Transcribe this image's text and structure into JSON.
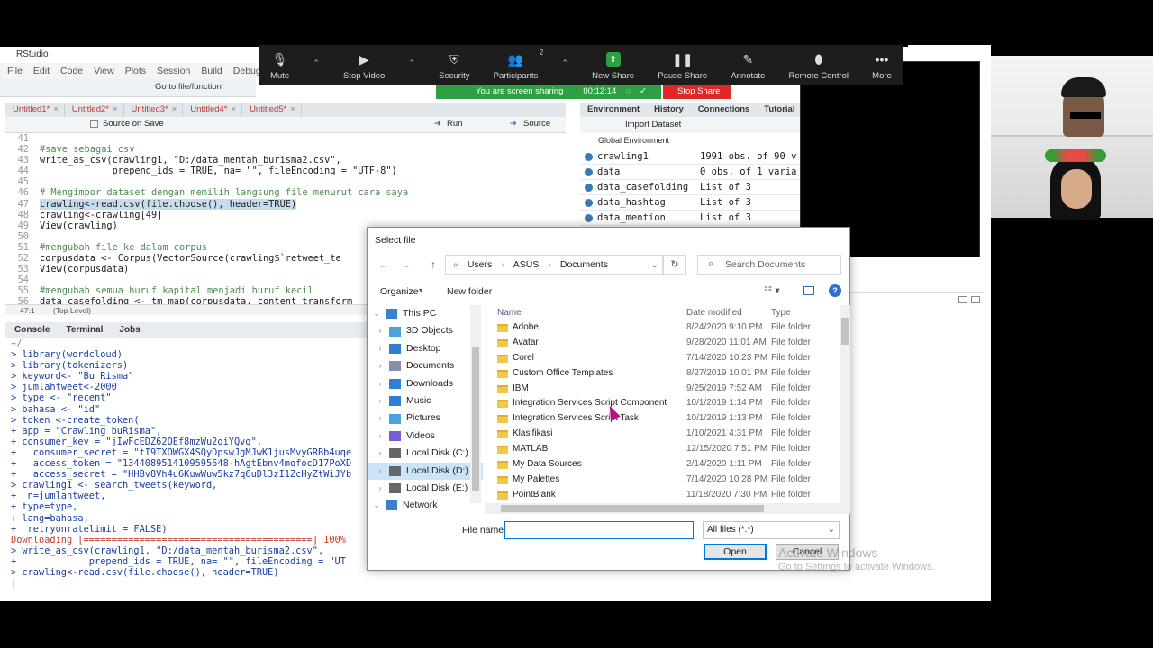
{
  "rstudio": {
    "title": "RStudio",
    "menu": [
      "File",
      "Edit",
      "Code",
      "View",
      "Plots",
      "Session",
      "Build",
      "Debug"
    ],
    "goto_placeholder": "Go to file/function",
    "editor_tabs": [
      "Untitled1*",
      "Untitled2*",
      "Untitled3*",
      "Untitled4*",
      "Untitled5*"
    ],
    "editor_toolbar": {
      "source_on_save": "Source on Save",
      "run": "Run",
      "source": "Source"
    },
    "code_lines": [
      {
        "n": "41",
        "text": ""
      },
      {
        "n": "42",
        "text": "#save sebagai csv",
        "comment": true
      },
      {
        "n": "43",
        "text": "write_as_csv(crawling1, \"D:/data_mentah_burisma2.csv\","
      },
      {
        "n": "44",
        "text": "             prepend_ids = TRUE, na= \"\", fileEncoding = \"UTF-8\")"
      },
      {
        "n": "45",
        "text": ""
      },
      {
        "n": "46",
        "text": "# Mengimpor dataset dengan memilih langsung file menurut cara saya",
        "comment": true
      },
      {
        "n": "47",
        "text": "crawling<-read.csv(file.choose(), header=TRUE)",
        "highlight": true
      },
      {
        "n": "48",
        "text": "crawling<-crawling[49]"
      },
      {
        "n": "49",
        "text": "View(crawling)"
      },
      {
        "n": "50",
        "text": ""
      },
      {
        "n": "51",
        "text": "#mengubah file ke dalam corpus",
        "comment": true
      },
      {
        "n": "52",
        "text": "corpusdata <- Corpus(VectorSource(crawling$`retweet_te"
      },
      {
        "n": "53",
        "text": "View(corpusdata)"
      },
      {
        "n": "54",
        "text": ""
      },
      {
        "n": "55",
        "text": "#mengubah semua huruf kapital menjadi huruf kecil",
        "comment": true
      },
      {
        "n": "56",
        "text": "data_casefolding <- tm_map(corpusdata, content_transform"
      }
    ],
    "editor_status": {
      "pos": "47:1",
      "scope": "(Top Level)"
    },
    "console_tabs": [
      "Console",
      "Terminal",
      "Jobs"
    ],
    "console_lines": [
      {
        "text": "~/",
        "kind": "plain"
      },
      {
        "text": "> library(wordcloud)"
      },
      {
        "text": "> library(tokenizers)"
      },
      {
        "text": "> keyword<- \"Bu Risma\""
      },
      {
        "text": "> jumlahtweet<-2000"
      },
      {
        "text": "> type <- \"recent\""
      },
      {
        "text": "> bahasa <- \"id\""
      },
      {
        "text": "> token <-create_token("
      },
      {
        "text": "+ app = \"Crawling buRisma\","
      },
      {
        "text": "+ consumer_key = \"jIwFcEDZ62OEf8mzWu2qiYQvg\","
      },
      {
        "text": "+   consumer_secret = \"tI9TXOWGX4SQyDpswJgMJwK1jusMvyGRBb4uqe"
      },
      {
        "text": "+   access_token = \"1344089514109595648-hAgtEbnv4mofocD17PoXD"
      },
      {
        "text": "+   access_secret = \"HHBv8Vh4u6KuwWuw5kz7q6uDl3zI1ZcHyZtWiJYb"
      },
      {
        "text": "> crawling1 <- search_tweets(keyword,"
      },
      {
        "text": "+  n=jumlahtweet,"
      },
      {
        "text": "+ type=type,"
      },
      {
        "text": "+ lang=bahasa,"
      },
      {
        "text": "+  retryonratelimit = FALSE)"
      },
      {
        "text": "Downloading [=========================================] 100%",
        "kind": "out"
      },
      {
        "text": "> write_as_csv(crawling1, \"D:/data_mentah_burisma2.csv\","
      },
      {
        "text": "+             prepend_ids = TRUE, na= \"\", fileEncoding = \"UT"
      },
      {
        "text": "> crawling<-read.csv(file.choose(), header=TRUE)"
      },
      {
        "text": "|",
        "kind": "plain"
      }
    ],
    "env_tabs": [
      "Environment",
      "History",
      "Connections",
      "Tutorial"
    ],
    "env_import": "Import Dataset",
    "env_global": "Global Environment",
    "env_rows": [
      {
        "name": "crawling1",
        "value": "1991 obs. of 90 v"
      },
      {
        "name": "data",
        "value": "0 obs. of 1 varia"
      },
      {
        "name": "data_casefolding",
        "value": "List of 3"
      },
      {
        "name": "data_hashtag",
        "value": "List of 3"
      },
      {
        "name": "data_mention",
        "value": "List of 3"
      }
    ]
  },
  "zoom": {
    "items": [
      {
        "label": "Mute",
        "icon": "microphone-icon",
        "glyph": "🎙"
      },
      {
        "label": "Stop Video",
        "icon": "video-camera-icon",
        "glyph": "▶"
      },
      {
        "label": "Security",
        "icon": "shield-icon",
        "glyph": "⛨"
      },
      {
        "label": "Participants",
        "icon": "participants-icon",
        "glyph": "👥",
        "badge": "2"
      },
      {
        "label": "New Share",
        "icon": "share-arrow-icon",
        "glyph": "⬆",
        "accent": "#2ea043"
      },
      {
        "label": "Pause Share",
        "icon": "pause-icon",
        "glyph": "❚❚"
      },
      {
        "label": "Annotate",
        "icon": "pencil-icon",
        "glyph": "✎"
      },
      {
        "label": "Remote Control",
        "icon": "mouse-icon",
        "glyph": "⬮"
      },
      {
        "label": "More",
        "icon": "more-dots-icon",
        "glyph": "•••"
      }
    ],
    "sharing_text": "You are screen sharing",
    "timer": "00:12:14",
    "stop_share": "Stop Share"
  },
  "dialog": {
    "title": "Select file",
    "breadcrumb": [
      "Users",
      "ASUS",
      "Documents"
    ],
    "search_placeholder": "Search Documents",
    "organize": "Organize",
    "new_folder": "New folder",
    "nav_items": [
      {
        "label": "This PC",
        "color": "#3d7fcf",
        "top": true
      },
      {
        "label": "3D Objects",
        "color": "#4aa3df"
      },
      {
        "label": "Desktop",
        "color": "#2f7fd2"
      },
      {
        "label": "Documents",
        "color": "#8a8fa8"
      },
      {
        "label": "Downloads",
        "color": "#2f7fd2"
      },
      {
        "label": "Music",
        "color": "#2f7fd2"
      },
      {
        "label": "Pictures",
        "color": "#4aa3df"
      },
      {
        "label": "Videos",
        "color": "#7a5bd1"
      },
      {
        "label": "Local Disk (C:)",
        "color": "#666"
      },
      {
        "label": "Local Disk (D:)",
        "color": "#666",
        "selected": true
      },
      {
        "label": "Local Disk (E:)",
        "color": "#666"
      },
      {
        "label": "Network",
        "color": "#3d7fcf",
        "top": true
      }
    ],
    "columns": {
      "name": "Name",
      "date": "Date modified",
      "type": "Type"
    },
    "files": [
      {
        "name": "Adobe",
        "date": "8/24/2020 9:10 PM",
        "type": "File folder"
      },
      {
        "name": "Avatar",
        "date": "9/28/2020 11:01 AM",
        "type": "File folder"
      },
      {
        "name": "Corel",
        "date": "7/14/2020 10:23 PM",
        "type": "File folder"
      },
      {
        "name": "Custom Office Templates",
        "date": "8/27/2019 10:01 PM",
        "type": "File folder"
      },
      {
        "name": "IBM",
        "date": "9/25/2019 7:52 AM",
        "type": "File folder"
      },
      {
        "name": "Integration Services Script Component",
        "date": "10/1/2019 1:14 PM",
        "type": "File folder"
      },
      {
        "name": "Integration Services Script Task",
        "date": "10/1/2019 1:13 PM",
        "type": "File folder"
      },
      {
        "name": "Klasifikasi",
        "date": "1/10/2021 4:31 PM",
        "type": "File folder"
      },
      {
        "name": "MATLAB",
        "date": "12/15/2020 7:51 PM",
        "type": "File folder"
      },
      {
        "name": "My Data Sources",
        "date": "2/14/2020 1:11 PM",
        "type": "File folder"
      },
      {
        "name": "My Palettes",
        "date": "7/14/2020 10:28 PM",
        "type": "File folder"
      },
      {
        "name": "PointBlank",
        "date": "11/18/2020 7:30 PM",
        "type": "File folder"
      }
    ],
    "file_name_label": "File name:",
    "file_name_value": "",
    "filter": "All files (*.*)",
    "open": "Open",
    "cancel": "Cancel"
  },
  "watermark": {
    "line1": "Activate Windows",
    "line2": "Go to Settings to activate Windows."
  }
}
